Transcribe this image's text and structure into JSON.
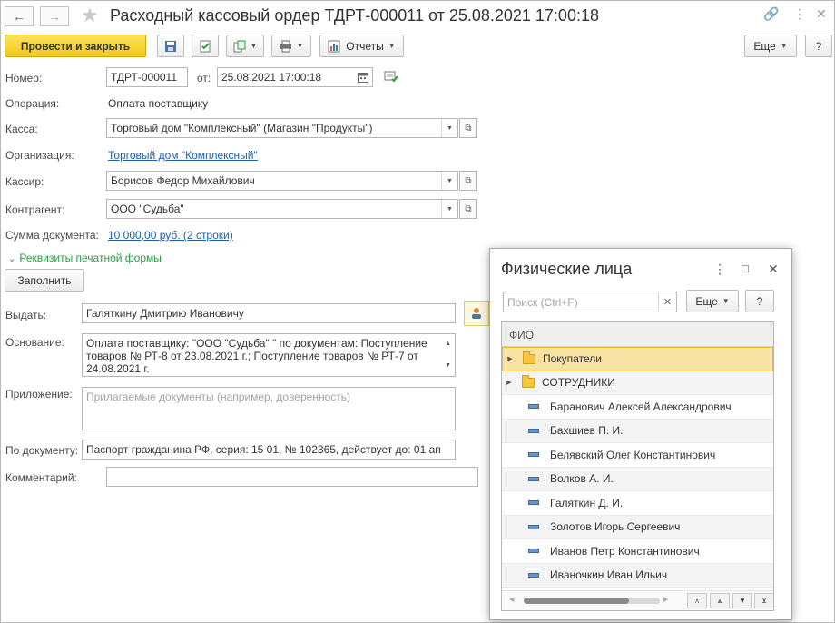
{
  "window": {
    "title": "Расходный кассовый ордер ТДРТ-000011 от 25.08.2021 17:00:18"
  },
  "toolbar": {
    "post_close_label": "Провести и закрыть",
    "reports_label": "Отчеты",
    "more_label": "Еще",
    "help_label": "?"
  },
  "form": {
    "number_label": "Номер:",
    "number_value": "ТДРТ-000011",
    "date_from_label": "от:",
    "date_value": "25.08.2021 17:00:18",
    "operation_label": "Операция:",
    "operation_value": "Оплата поставщику",
    "cash_label": "Касса:",
    "cash_value": "Торговый дом \"Комплексный\" (Магазин \"Продукты\")",
    "org_label": "Организация:",
    "org_value": "Торговый дом \"Комплексный\"",
    "cashier_label": "Кассир:",
    "cashier_value": "Борисов Федор Михайлович",
    "contractor_label": "Контрагент:",
    "contractor_value": "ООО \"Судьба\"",
    "sum_label": "Сумма документа:",
    "sum_value": "10 000,00 руб. (2 строки)",
    "print_details_label": "Реквизиты печатной формы",
    "fill_button_label": "Заполнить",
    "issue_label": "Выдать:",
    "issue_value": "Галяткину Дмитрию Ивановичу",
    "basis_label": "Основание:",
    "basis_value": "Оплата поставщику: \"ООО \"Судьба\" \" по документам: Поступление товаров № РТ-8 от 23.08.2021 г.; Поступление товаров № РТ-7 от 24.08.2021 г.",
    "attachment_label": "Приложение:",
    "attachment_placeholder": "Прилагаемые документы (например, доверенность)",
    "by_document_label": "По документу:",
    "by_document_value": "Паспорт гражданина РФ, серия: 15 01, № 102365, действует до: 01 ап",
    "comment_label": "Комментарий:",
    "comment_value": ""
  },
  "popup": {
    "title": "Физические лица",
    "search_placeholder": "Поиск (Ctrl+F)",
    "more_label": "Еще",
    "help_label": "?",
    "column_header": "ФИО",
    "rows": [
      {
        "label": "Покупатели",
        "kind": "folder",
        "selected": true
      },
      {
        "label": "СОТРУДНИКИ",
        "kind": "folder",
        "selected": false
      },
      {
        "label": "Баранович Алексей Александрович",
        "kind": "item",
        "selected": false
      },
      {
        "label": "Бахшиев П. И.",
        "kind": "item",
        "selected": false
      },
      {
        "label": "Белявский Олег Константинович",
        "kind": "item",
        "selected": false
      },
      {
        "label": "Волков А. И.",
        "kind": "item",
        "selected": false
      },
      {
        "label": "Галяткин Д. И.",
        "kind": "item",
        "selected": false
      },
      {
        "label": "Золотов Игорь Сергеевич",
        "kind": "item",
        "selected": false
      },
      {
        "label": "Иванов  Петр  Константинович",
        "kind": "item",
        "selected": false
      },
      {
        "label": "Иваночкин Иван Ильич",
        "kind": "item",
        "selected": false
      }
    ]
  },
  "colors": {
    "primary_button": "#f3c916",
    "link": "#1a5fb4",
    "selected_row": "#f9e3a4",
    "green_accent": "#2d9b4a"
  }
}
